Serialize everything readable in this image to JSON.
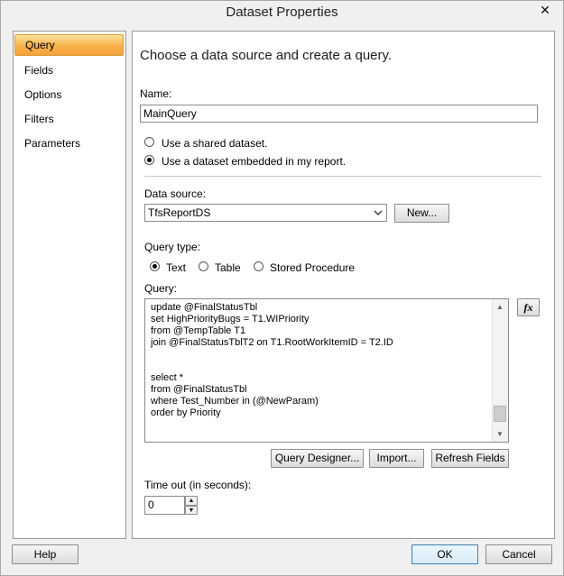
{
  "window": {
    "title": "Dataset Properties",
    "close_glyph": "✕"
  },
  "nav": {
    "items": [
      {
        "label": "Query",
        "selected": true
      },
      {
        "label": "Fields"
      },
      {
        "label": "Options"
      },
      {
        "label": "Filters"
      },
      {
        "label": "Parameters"
      }
    ]
  },
  "main": {
    "heading": "Choose a data source and create a query.",
    "name_label": "Name:",
    "name_value": "MainQuery",
    "radio_shared": "Use a shared dataset.",
    "radio_embedded": "Use a dataset embedded in my report.",
    "selected_dataset_option": "embedded",
    "datasource_label": "Data source:",
    "datasource_value": "TfsReportDS",
    "new_button": "New...",
    "querytype_label": "Query type:",
    "querytype_options": [
      "Text",
      "Table",
      "Stored Procedure"
    ],
    "querytype_selected": "Text",
    "query_label": "Query:",
    "query_lines": [
      "update @FinalStatusTbl",
      "set HighPriorityBugs = T1.WIPriority",
      "from @TempTable T1",
      "join @FinalStatusTblT2 on T1.RootWorkItemID = T2.ID",
      "",
      "",
      "select *",
      "from @FinalStatusTbl",
      "where Test_Number in (@NewParam)",
      "order by Priority"
    ],
    "fx_button": "fx",
    "query_designer_button": "Query Designer...",
    "import_button": "Import...",
    "refresh_fields_button": "Refresh Fields",
    "timeout_label": "Time out (in seconds):",
    "timeout_value": "0"
  },
  "footer": {
    "help_button": "Help",
    "ok_button": "OK",
    "cancel_button": "Cancel"
  }
}
